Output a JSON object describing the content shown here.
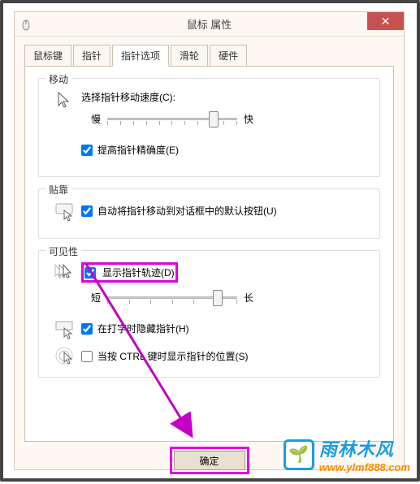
{
  "window": {
    "title": "鼠标 属性",
    "close_glyph": "✕"
  },
  "tabs": {
    "t0": "鼠标键",
    "t1": "指针",
    "t2": "指针选项",
    "t3": "滑轮",
    "t4": "硬件"
  },
  "motion": {
    "group": "移动",
    "speed_label": "选择指针移动速度(C):",
    "slow": "慢",
    "fast": "快",
    "precision": "提高指针精确度(E)"
  },
  "snap": {
    "group": "贴靠",
    "label": "自动将指针移动到对话框中的默认按钮(U)"
  },
  "visibility": {
    "group": "可见性",
    "trails_label": "显示指针轨迹(D)",
    "short": "短",
    "long": "长",
    "hide_typing": "在打字时隐藏指针(H)",
    "ctrl_locate": "当按 CTRL 键时显示指针的位置(S)"
  },
  "buttons": {
    "ok": "确定"
  },
  "watermark": {
    "cn": "雨林木风",
    "url": "www.ylmf888.com",
    "emoji": "🌱"
  }
}
